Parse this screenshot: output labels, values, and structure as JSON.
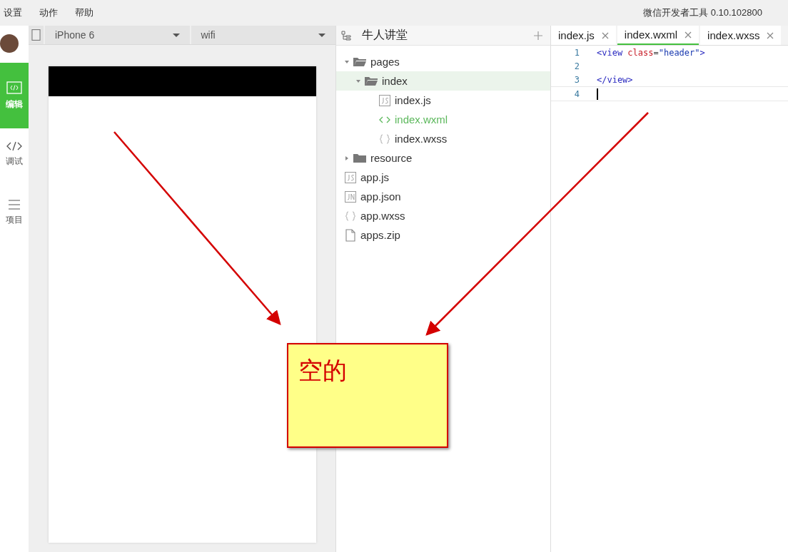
{
  "menu": [
    "设置",
    "动作",
    "帮助"
  ],
  "window": {
    "title": "微信开发者工具 0.10.102800"
  },
  "sidebar": {
    "items": [
      {
        "label": "编辑",
        "kind": "edit",
        "selected": true
      },
      {
        "label": "调试",
        "kind": "debug",
        "selected": false
      },
      {
        "label": "项目",
        "kind": "project",
        "selected": false
      }
    ]
  },
  "simulator": {
    "device": "iPhone 6",
    "network": "wifi"
  },
  "project": {
    "name": "牛人讲堂",
    "tree": [
      {
        "label": "pages",
        "kind": "folder",
        "expanded": true,
        "selected": false,
        "current": false,
        "children": [
          {
            "label": "index",
            "kind": "folder",
            "expanded": true,
            "selected": true,
            "current": false,
            "children": [
              {
                "label": "index.js",
                "kind": "js",
                "selected": false,
                "current": false
              },
              {
                "label": "index.wxml",
                "kind": "wxml",
                "selected": false,
                "current": true
              },
              {
                "label": "index.wxss",
                "kind": "wxss",
                "selected": false,
                "current": false
              }
            ]
          }
        ]
      },
      {
        "label": "resource",
        "kind": "folder",
        "expanded": false,
        "selected": false,
        "current": false
      },
      {
        "label": "app.js",
        "kind": "js",
        "selected": false,
        "current": false
      },
      {
        "label": "app.json",
        "kind": "json",
        "selected": false,
        "current": false
      },
      {
        "label": "app.wxss",
        "kind": "wxss",
        "selected": false,
        "current": false
      },
      {
        "label": "apps.zip",
        "kind": "file",
        "selected": false,
        "current": false
      }
    ]
  },
  "editor": {
    "tabs": [
      {
        "label": "index.js",
        "selected": false
      },
      {
        "label": "index.wxml",
        "selected": true
      },
      {
        "label": "index.wxss",
        "selected": false
      }
    ],
    "lines": [
      {
        "number": "1",
        "tokens": [
          {
            "kind": "tag",
            "text": "<view"
          },
          {
            "kind": "attr",
            "text": " class"
          },
          {
            "kind": "plain",
            "text": "="
          },
          {
            "kind": "string",
            "text": "\"header\""
          },
          {
            "kind": "tag",
            "text": ">"
          }
        ]
      },
      {
        "number": "2"
      },
      {
        "number": "3",
        "tokens": [
          {
            "kind": "tag",
            "text": "</view>"
          }
        ]
      },
      {
        "number": "4",
        "cursor": true
      }
    ]
  },
  "annotation": {
    "note": "空的"
  }
}
